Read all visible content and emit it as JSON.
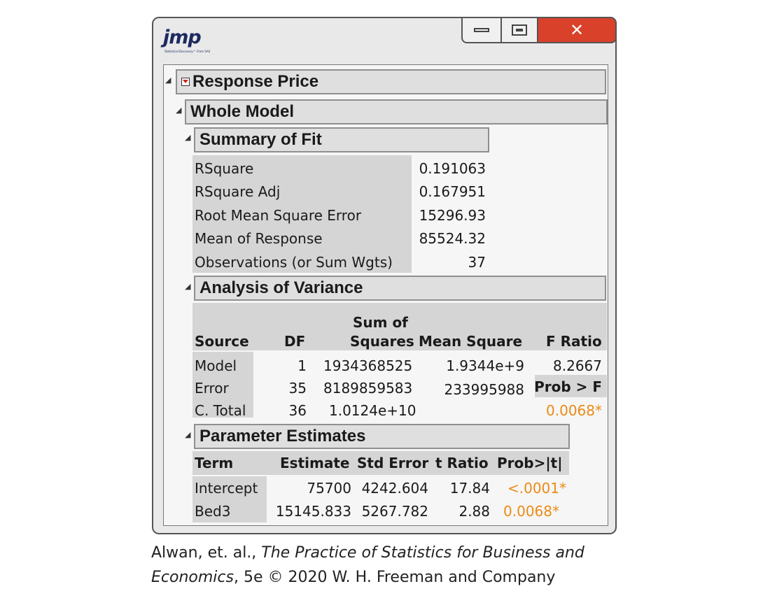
{
  "app": {
    "logo": "jmp",
    "logo_tagline": "Statistical Discovery™ From SAS"
  },
  "window_controls": {
    "minimize": "minimize-icon",
    "maximize": "maximize-icon",
    "close": "close-icon"
  },
  "report": {
    "response_title": "Response Price",
    "whole_model_title": "Whole Model",
    "summary_of_fit": {
      "title": "Summary of Fit",
      "rows": [
        {
          "label": "RSquare",
          "value": "0.191063"
        },
        {
          "label": "RSquare Adj",
          "value": "0.167951"
        },
        {
          "label": "Root Mean Square Error",
          "value": "15296.93"
        },
        {
          "label": "Mean of Response",
          "value": "85524.32"
        },
        {
          "label": "Observations (or Sum Wgts)",
          "value": "37"
        }
      ]
    },
    "anova": {
      "title": "Analysis of Variance",
      "headers": {
        "source": "Source",
        "df": "DF",
        "ss_line1": "Sum of",
        "ss_line2": "Squares",
        "ms": "Mean  Square",
        "f": "F  Ratio"
      },
      "rows": [
        {
          "source": "Model",
          "df": "1",
          "ss": "1934368525",
          "ms": "1.9344e+9",
          "f": "8.2667"
        },
        {
          "source": "Error",
          "df": "35",
          "ss": "8189859583",
          "ms": "233995988",
          "f": "Prob > F"
        },
        {
          "source": "C. Total",
          "df": "36",
          "ss": "1.0124e+10",
          "ms": "",
          "f": "0.0068*"
        }
      ]
    },
    "parameter_estimates": {
      "title": "Parameter Estimates",
      "headers": {
        "term": "Term",
        "estimate": "Estimate",
        "std_error": "Std Error",
        "t_ratio": "t Ratio",
        "prob": "Prob>|t|"
      },
      "rows": [
        {
          "term": "Intercept",
          "estimate": "75700",
          "std_error": "4242.604",
          "t_ratio": "17.84",
          "prob": "<.0001*"
        },
        {
          "term": "Bed3",
          "estimate": "15145.833",
          "std_error": "5267.782",
          "t_ratio": "2.88",
          "prob": "0.0068*"
        }
      ]
    }
  },
  "caption": {
    "authors": "Alwan, et. al., ",
    "book_title_1": "The Practice of Statistics for Business and",
    "book_title_2": "Economics",
    "edition_and_copyright": ", 5e © 2020 W. H. Freeman and Company"
  },
  "colors": {
    "significant": "#ea8b16",
    "close_button": "#d9412b",
    "logo": "#1d2a60"
  }
}
